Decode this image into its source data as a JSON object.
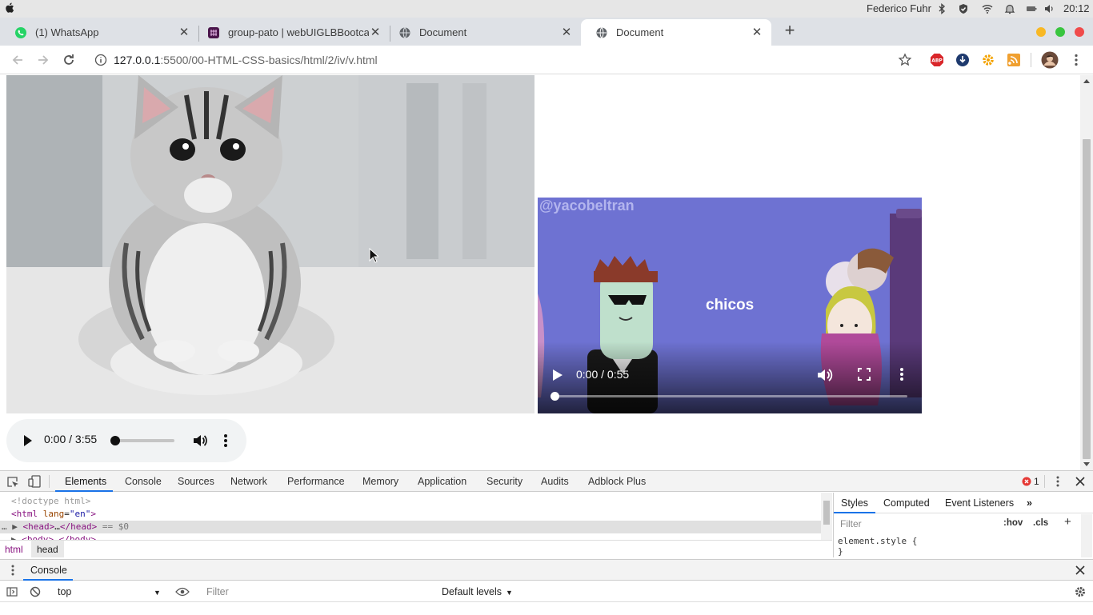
{
  "os": {
    "user": "Federico Fuhr",
    "clock": "20:12"
  },
  "tabs": [
    {
      "title": "(1) WhatsApp",
      "favicon": "whatsapp-icon"
    },
    {
      "title": "group-pato | webUIGLBBootca",
      "favicon": "slack-icon"
    },
    {
      "title": "Document",
      "favicon": "globe-icon"
    },
    {
      "title": "Document",
      "favicon": "globe-icon",
      "active": true
    }
  ],
  "toolbar": {
    "url_host": "127.0.0.1",
    "url_rest": ":5500/00-HTML-CSS-basics/html/2/iv/v.html"
  },
  "page": {
    "video": {
      "watermark": "@yacobeltran",
      "caption": "chicos",
      "time": "0:00 / 0:55"
    },
    "audio": {
      "time": "0:00 / 3:55"
    }
  },
  "devtools": {
    "tabs": [
      "Elements",
      "Console",
      "Sources",
      "Network",
      "Performance",
      "Memory",
      "Application",
      "Security",
      "Audits",
      "Adblock Plus"
    ],
    "error_count": "1",
    "dom": {
      "doctype": "<!doctype html>",
      "html_open_tag": "html",
      "html_attr_name": "lang",
      "html_attr_value": "\"en\"",
      "head_line_tag": "head",
      "head_suffix": "== $0",
      "body_tag": "body"
    },
    "breadcrumbs": [
      "html",
      "head"
    ],
    "styles_tabs": [
      "Styles",
      "Computed",
      "Event Listeners"
    ],
    "styles_filter_placeholder": "Filter",
    "hov_label": ":hov",
    "cls_label": ".cls",
    "element_style_selector": "element.style {",
    "element_style_close": "}",
    "console": {
      "title": "Console",
      "context": "top",
      "filter_placeholder": "Filter",
      "levels": "Default levels"
    }
  }
}
